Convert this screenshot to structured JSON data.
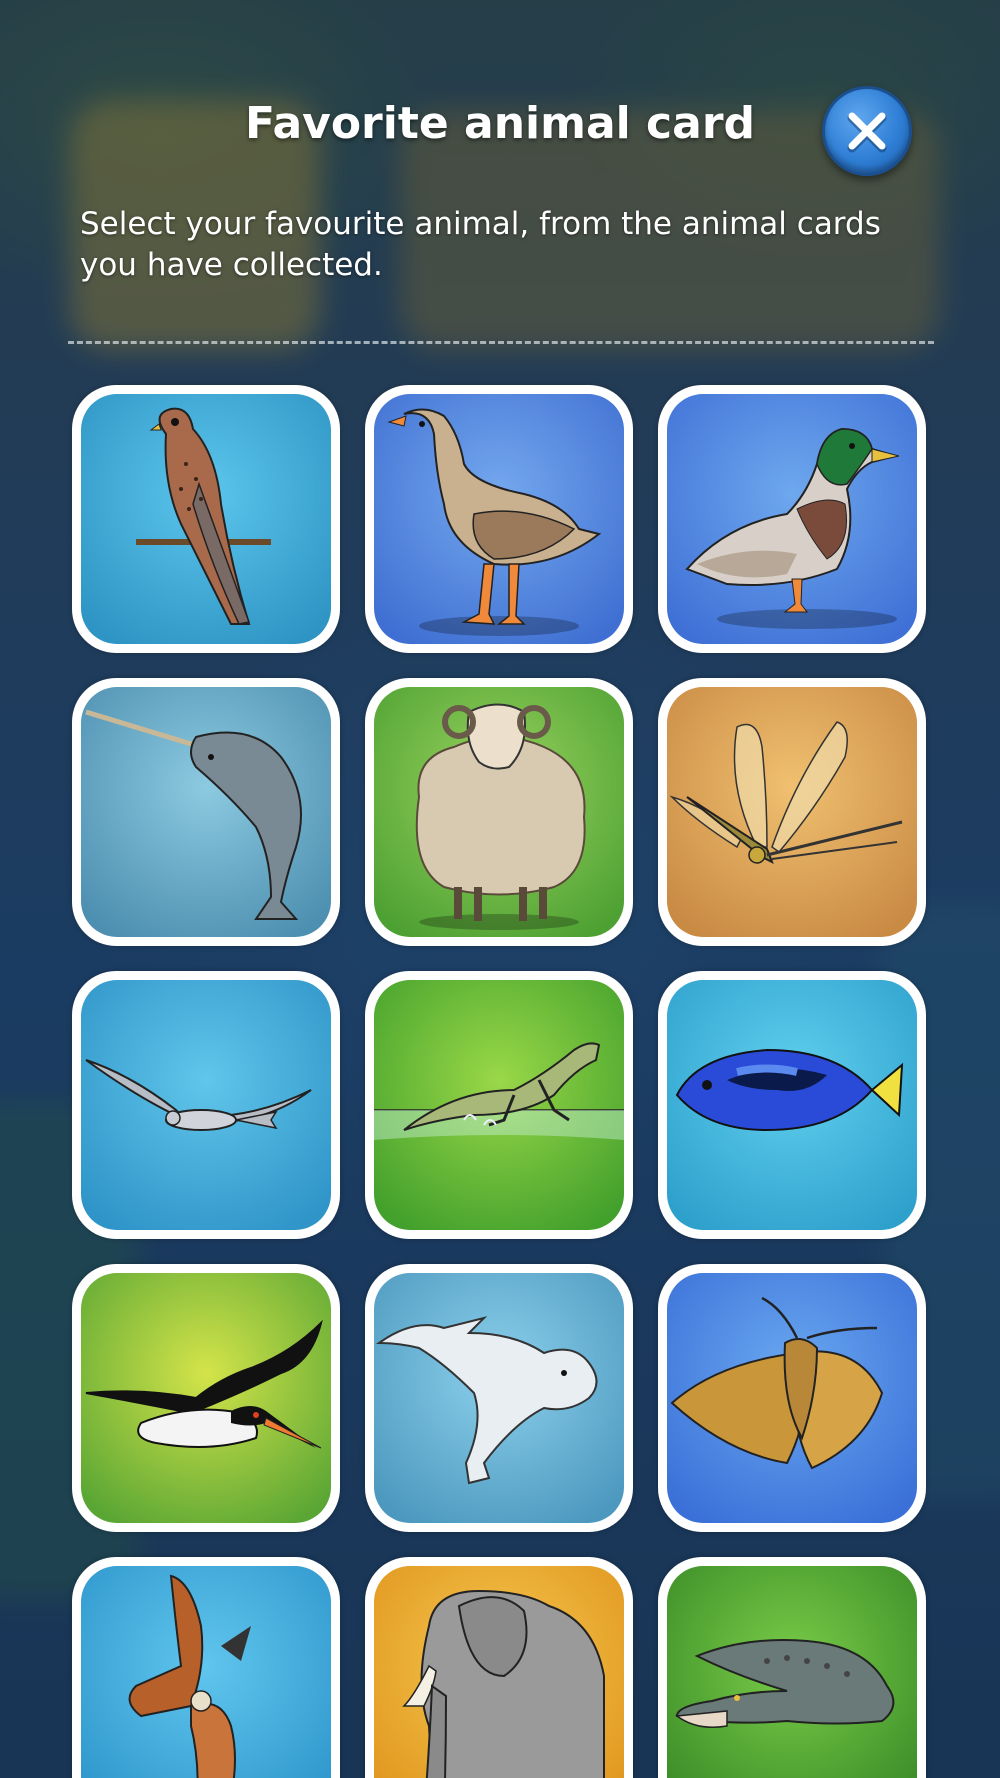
{
  "dialog": {
    "title": "Favorite animal card",
    "instructions": "Select your favourite animal, from the animal cards you have collected.",
    "close_icon": "close-icon"
  },
  "cards": [
    {
      "animal": "kestrel",
      "bg": [
        "#5cc6ec",
        "#2e94c4"
      ]
    },
    {
      "animal": "goose",
      "bg": [
        "#74a8ee",
        "#3f6fd2"
      ]
    },
    {
      "animal": "mallard",
      "bg": [
        "#6ea8ee",
        "#3f70d6"
      ]
    },
    {
      "animal": "narwhal",
      "bg": [
        "#8ccae0",
        "#4d8fb0"
      ]
    },
    {
      "animal": "sheep",
      "bg": [
        "#9ad460",
        "#4da032"
      ]
    },
    {
      "animal": "dragonfly",
      "bg": [
        "#f0c070",
        "#c98a44"
      ]
    },
    {
      "animal": "harrier",
      "bg": [
        "#60c6ea",
        "#2f94c8"
      ]
    },
    {
      "animal": "basilisk-lizard",
      "bg": [
        "#9ad848",
        "#42a02c"
      ]
    },
    {
      "animal": "blue-tang-fish",
      "bg": [
        "#60d0ee",
        "#2ea0cc"
      ]
    },
    {
      "animal": "oystercatcher",
      "bg": [
        "#d4e44a",
        "#5aa634"
      ]
    },
    {
      "animal": "beluga",
      "bg": [
        "#8cd0ec",
        "#4c98be"
      ]
    },
    {
      "animal": "moth",
      "bg": [
        "#6aa8f0",
        "#3a70d8"
      ]
    },
    {
      "animal": "red-kite",
      "bg": [
        "#60c6ee",
        "#2f96cc"
      ]
    },
    {
      "animal": "elephant",
      "bg": [
        "#f6c850",
        "#e0961e"
      ]
    },
    {
      "animal": "crocodile",
      "bg": [
        "#7acc48",
        "#3a8c28"
      ]
    }
  ]
}
